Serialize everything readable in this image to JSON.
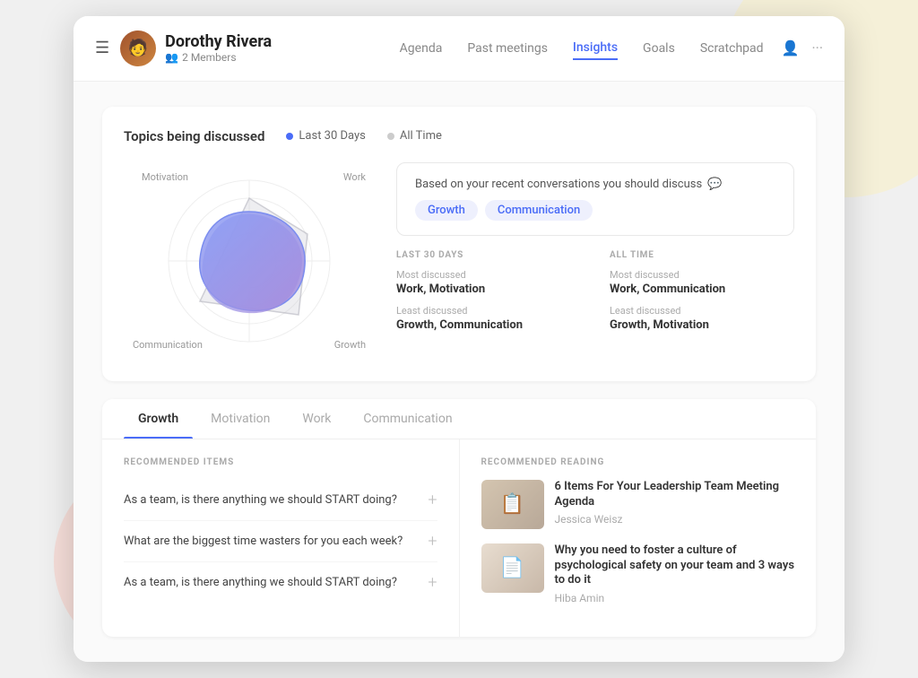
{
  "background": {
    "circle_yellow": "decorative",
    "circle_pink": "decorative"
  },
  "header": {
    "menu_icon": "☰",
    "user_name": "Dorothy Rivera",
    "members_label": "2 Members",
    "members_icon": "👥",
    "nav": [
      {
        "label": "Agenda",
        "active": false
      },
      {
        "label": "Past meetings",
        "active": false
      },
      {
        "label": "Insights",
        "active": true
      },
      {
        "label": "Goals",
        "active": false
      },
      {
        "label": "Scratchpad",
        "active": false
      }
    ],
    "action_person_icon": "👤",
    "action_more_icon": "···"
  },
  "topics": {
    "title": "Topics being discussed",
    "legend_last30": "Last 30 Days",
    "legend_alltime": "All Time",
    "radar_labels": {
      "top_left": "Motivation",
      "top_right": "Work",
      "bottom_left": "Communication",
      "bottom_right": "Growth"
    }
  },
  "suggest": {
    "title": "Based on your recent conversations you should discuss",
    "icon": "💬",
    "tags": [
      "Growth",
      "Communication"
    ]
  },
  "stats": {
    "last30": {
      "period": "Last 30 Days",
      "most_discussed_label": "Most discussed",
      "most_discussed_value": "Work, Motivation",
      "least_discussed_label": "Least discussed",
      "least_discussed_value": "Growth, Communication"
    },
    "alltime": {
      "period": "All Time",
      "most_discussed_label": "Most discussed",
      "most_discussed_value": "Work, Communication",
      "least_discussed_label": "Least discussed",
      "least_discussed_value": "Growth, Motivation"
    }
  },
  "tabs": [
    {
      "label": "Growth",
      "active": true
    },
    {
      "label": "Motivation",
      "active": false
    },
    {
      "label": "Work",
      "active": false
    },
    {
      "label": "Communication",
      "active": false
    }
  ],
  "recommended_items": {
    "section_label": "Recommended Items",
    "items": [
      "As a team, is there anything we should START doing?",
      "What are the biggest time wasters for you each week?",
      "As a team, is there anything we should START doing?"
    ]
  },
  "recommended_reading": {
    "section_label": "Recommended Reading",
    "items": [
      {
        "title": "6 Items For Your Leadership Team Meeting Agenda",
        "author": "Jessica Weisz"
      },
      {
        "title": "Why you need to foster a culture of psychological safety on your team and 3 ways to do it",
        "author": "Hiba Amin"
      }
    ]
  }
}
